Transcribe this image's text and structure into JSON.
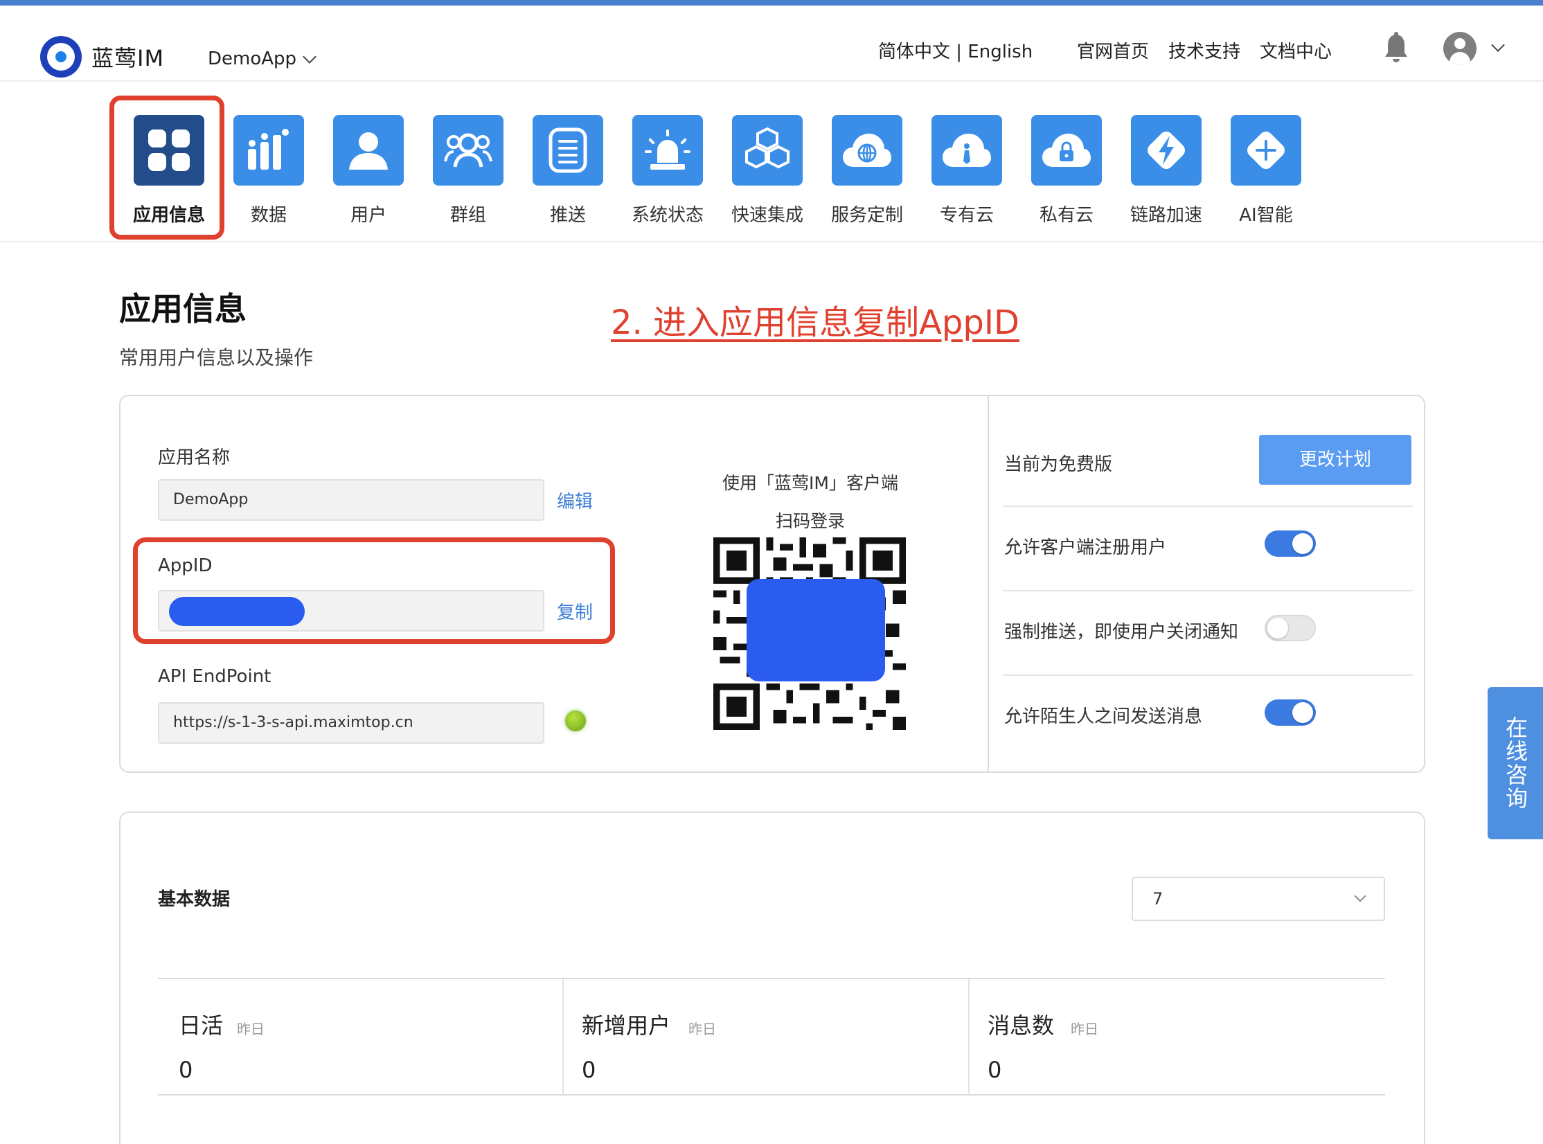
{
  "header": {
    "logo_text": "蓝莺IM",
    "app_name": "DemoApp",
    "lang": "简体中文 | English",
    "links": [
      "官网首页",
      "技术支持",
      "文档中心"
    ]
  },
  "nav": {
    "items": [
      {
        "label": "应用信息",
        "icon": "apps-grid-icon",
        "active": true
      },
      {
        "label": "数据",
        "icon": "bar-chart-icon"
      },
      {
        "label": "用户",
        "icon": "user-icon"
      },
      {
        "label": "群组",
        "icon": "group-icon"
      },
      {
        "label": "推送",
        "icon": "document-list-icon"
      },
      {
        "label": "系统状态",
        "icon": "alarm-light-icon"
      },
      {
        "label": "快速集成",
        "icon": "cubes-icon"
      },
      {
        "label": "服务定制",
        "icon": "cloud-globe-icon"
      },
      {
        "label": "专有云",
        "icon": "cloud-tie-icon"
      },
      {
        "label": "私有云",
        "icon": "cloud-lock-icon"
      },
      {
        "label": "链路加速",
        "icon": "lightning-icon"
      },
      {
        "label": "AI智能",
        "icon": "plus-icon"
      }
    ]
  },
  "page": {
    "title": "应用信息",
    "subtitle": "常用用户信息以及操作",
    "annotation": "2. 进入应用信息复制AppID"
  },
  "app_info": {
    "name_label": "应用名称",
    "name_value": "DemoApp",
    "edit_label": "编辑",
    "appid_label": "AppID",
    "copy_label": "复制",
    "endpoint_label": "API EndPoint",
    "endpoint_value": "https://s-1-3-s-api.maximtop.cn",
    "qr_caption_1": "使用「蓝莺IM」客户端",
    "qr_caption_2": "扫码登录"
  },
  "plan": {
    "current": "当前为免费版",
    "change_button": "更改计划",
    "settings": [
      {
        "label": "允许客户端注册用户",
        "enabled": true
      },
      {
        "label": "强制推送，即使用户关闭通知",
        "enabled": false
      },
      {
        "label": "允许陌生人之间发送消息",
        "enabled": true
      }
    ]
  },
  "stats": {
    "title": "基本数据",
    "range_value": "7",
    "items": [
      {
        "name": "日活",
        "tag": "昨日",
        "value": "0"
      },
      {
        "name": "新增用户",
        "tag": "昨日",
        "value": "0"
      },
      {
        "name": "消息数",
        "tag": "昨日",
        "value": "0"
      }
    ]
  },
  "side": {
    "consult": "在线咨询"
  },
  "colors": {
    "accent": "#3b8ee8",
    "annotation": "#e0402e",
    "mask": "#2a5cf0"
  }
}
